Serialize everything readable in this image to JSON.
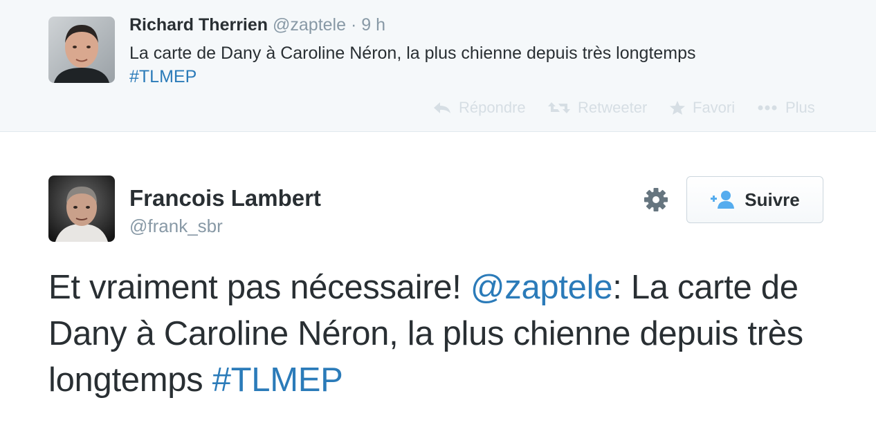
{
  "parent_tweet": {
    "author_name": "Richard Therrien",
    "author_handle": "@zaptele",
    "separator": "·",
    "time": "9 h",
    "text": "La carte de Dany à Caroline Néron, la plus chienne depuis très longtemps",
    "hashtag": "#TLMEP",
    "actions": {
      "reply": {
        "label": "Répondre",
        "icon": "reply-icon"
      },
      "retweet": {
        "label": "Retweeter",
        "icon": "retweet-icon"
      },
      "favorite": {
        "label": "Favori",
        "icon": "star-icon"
      },
      "more": {
        "label": "Plus",
        "icon": "more-icon"
      }
    }
  },
  "main_tweet": {
    "author_name": "Francois Lambert",
    "author_handle": "@frank_sbr",
    "follow_label": "Suivre",
    "text_1": "Et vraiment pas nécessaire! ",
    "mention": "@zaptele",
    "text_2": ": La carte de Dany à Caroline Néron, la plus chienne depuis très longtemps ",
    "hashtag": "#TLMEP"
  },
  "colors": {
    "link": "#2b7bb9",
    "text": "#292f33",
    "muted": "#8899a6",
    "action": "#d6dee4",
    "parent_bg": "#f5f8fa"
  }
}
